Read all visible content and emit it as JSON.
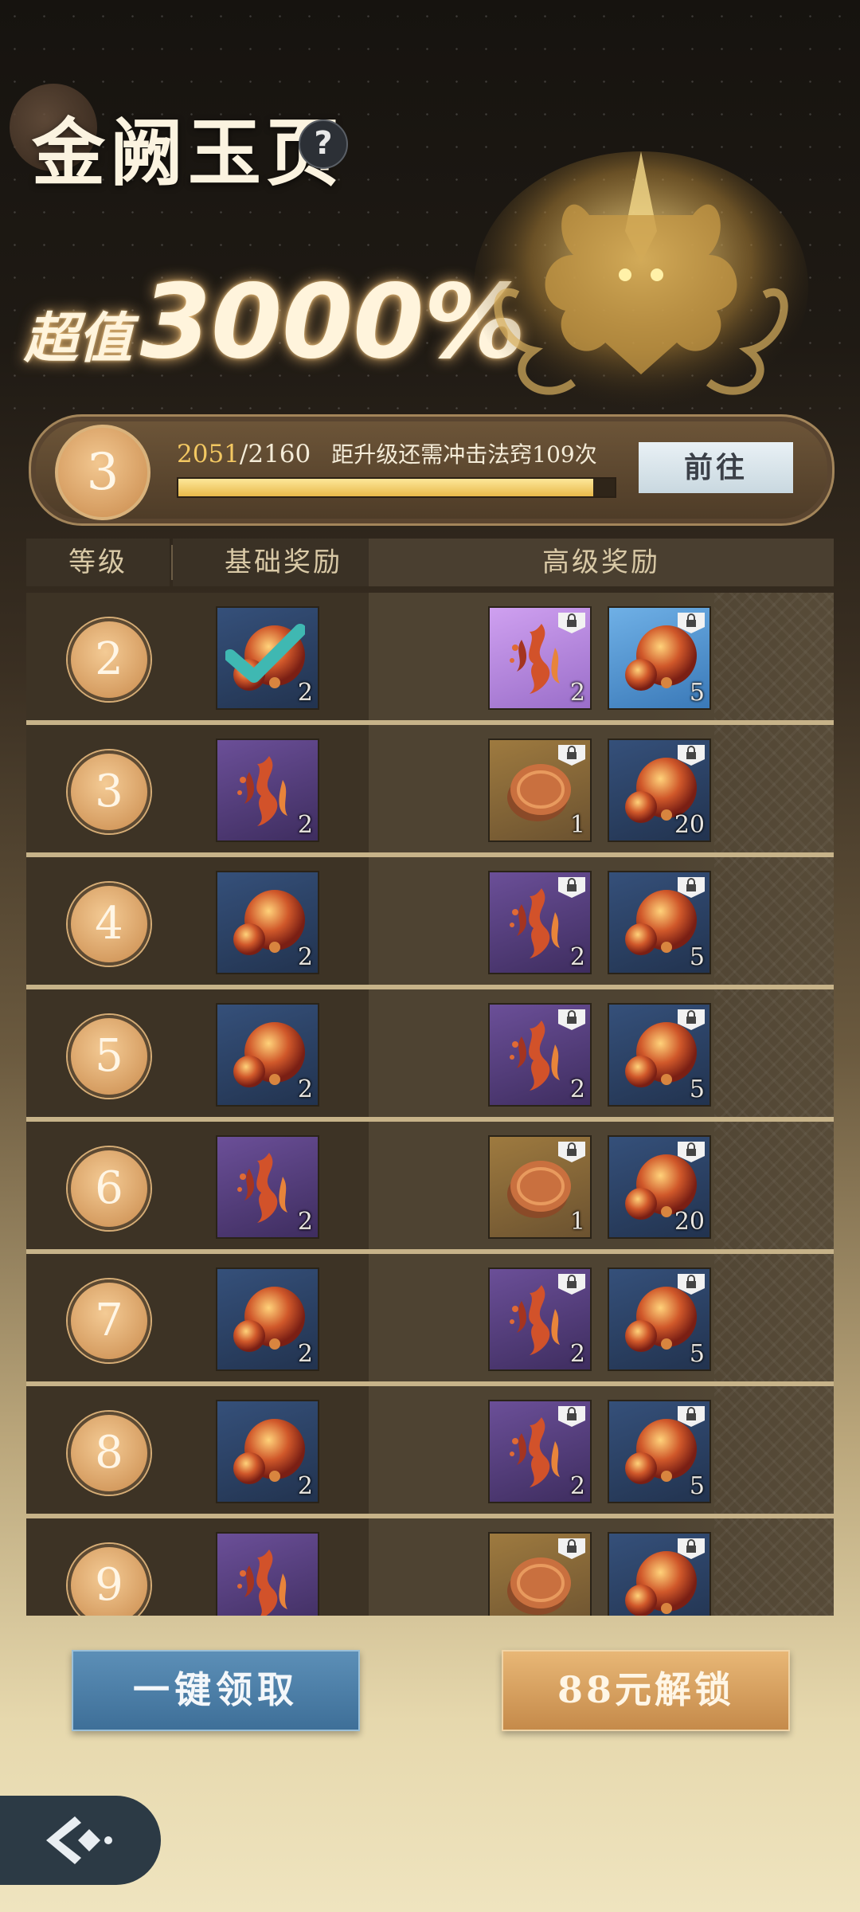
{
  "header": {
    "title": "金阙玉页",
    "help_label": "?",
    "slogan_prefix": "超值",
    "slogan_value": "3000%"
  },
  "progress": {
    "level": "3",
    "current": "2051",
    "total": "/2160",
    "fraction": 0.95,
    "hint": "距升级还需冲击法窍109次",
    "go_label": "前往"
  },
  "table": {
    "headers": {
      "level": "等级",
      "base": "基础奖励",
      "advanced": "高级奖励"
    },
    "rows": [
      {
        "level": "2",
        "base": {
          "type": "orb",
          "bg": "blue",
          "count": "2",
          "claimed": true
        },
        "adv": [
          {
            "type": "flame",
            "bg": "bright-purple",
            "count": "2"
          },
          {
            "type": "orb",
            "bg": "bright-blue",
            "count": "5"
          }
        ]
      },
      {
        "level": "3",
        "base": {
          "type": "flame",
          "bg": "purple",
          "count": "2",
          "claimed": false
        },
        "adv": [
          {
            "type": "coin",
            "bg": "gold",
            "count": "1"
          },
          {
            "type": "orb",
            "bg": "blue",
            "count": "20"
          }
        ]
      },
      {
        "level": "4",
        "base": {
          "type": "orb",
          "bg": "blue",
          "count": "2",
          "claimed": false
        },
        "adv": [
          {
            "type": "flame",
            "bg": "purple",
            "count": "2"
          },
          {
            "type": "orb",
            "bg": "blue",
            "count": "5"
          }
        ]
      },
      {
        "level": "5",
        "base": {
          "type": "orb",
          "bg": "blue",
          "count": "2",
          "claimed": false
        },
        "adv": [
          {
            "type": "flame",
            "bg": "purple",
            "count": "2"
          },
          {
            "type": "orb",
            "bg": "blue",
            "count": "5"
          }
        ]
      },
      {
        "level": "6",
        "base": {
          "type": "flame",
          "bg": "purple",
          "count": "2",
          "claimed": false
        },
        "adv": [
          {
            "type": "coin",
            "bg": "gold",
            "count": "1"
          },
          {
            "type": "orb",
            "bg": "blue",
            "count": "20"
          }
        ]
      },
      {
        "level": "7",
        "base": {
          "type": "orb",
          "bg": "blue",
          "count": "2",
          "claimed": false
        },
        "adv": [
          {
            "type": "flame",
            "bg": "purple",
            "count": "2"
          },
          {
            "type": "orb",
            "bg": "blue",
            "count": "5"
          }
        ]
      },
      {
        "level": "8",
        "base": {
          "type": "orb",
          "bg": "blue",
          "count": "2",
          "claimed": false
        },
        "adv": [
          {
            "type": "flame",
            "bg": "purple",
            "count": "2"
          },
          {
            "type": "orb",
            "bg": "blue",
            "count": "5"
          }
        ]
      },
      {
        "level": "9",
        "base": {
          "type": "flame",
          "bg": "purple",
          "count": "",
          "claimed": false
        },
        "adv": [
          {
            "type": "coin",
            "bg": "gold",
            "count": ""
          },
          {
            "type": "orb",
            "bg": "blue",
            "count": ""
          }
        ]
      }
    ]
  },
  "actions": {
    "claim_all_label": "一键领取",
    "unlock_label": "88元解锁"
  },
  "icons": {
    "back": "back-arrow-icon",
    "lock": "lock-icon",
    "check": "checkmark-icon",
    "help": "help-icon"
  },
  "colors": {
    "accent_gold": "#f3c862",
    "check_teal": "#3fb8b2",
    "claim_blue": "#4e80a8",
    "unlock_gold": "#d89f5e"
  }
}
